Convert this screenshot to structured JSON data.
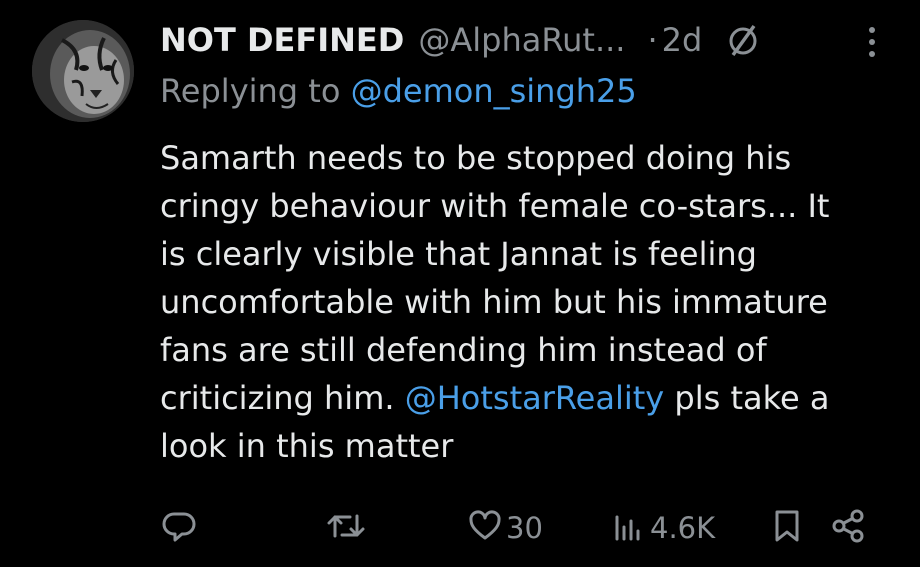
{
  "tweet": {
    "display_name": "NOT DEFINED",
    "handle": "@AlphaRut...",
    "separator": "·",
    "time": "2d",
    "replying_prefix": "Replying to ",
    "replying_to": "@demon_singh25",
    "body_lines": [
      "Samarth needs to be stopped doing his",
      "cringy behaviour with female co-stars... It",
      "is clearly visible that Jannat is feeling",
      "uncomfortable with him but his immature",
      "fans are still defending him instead of"
    ],
    "body_line6_before": "criticizing him. ",
    "body_line6_mention": "@HotstarReality",
    "body_line6_after": " pls take a",
    "body_line7": "look in this matter"
  },
  "actions": {
    "likes": "30",
    "views": "4.6K"
  },
  "icons": [
    "avatar-tiger",
    "grok-icon",
    "more-icon",
    "reply-icon",
    "retweet-icon",
    "like-icon",
    "views-icon",
    "bookmark-icon",
    "share-icon"
  ],
  "colors": {
    "background": "#000000",
    "text": "#e7e9ea",
    "muted": "#8b9095",
    "mention": "#4a9fe8"
  }
}
